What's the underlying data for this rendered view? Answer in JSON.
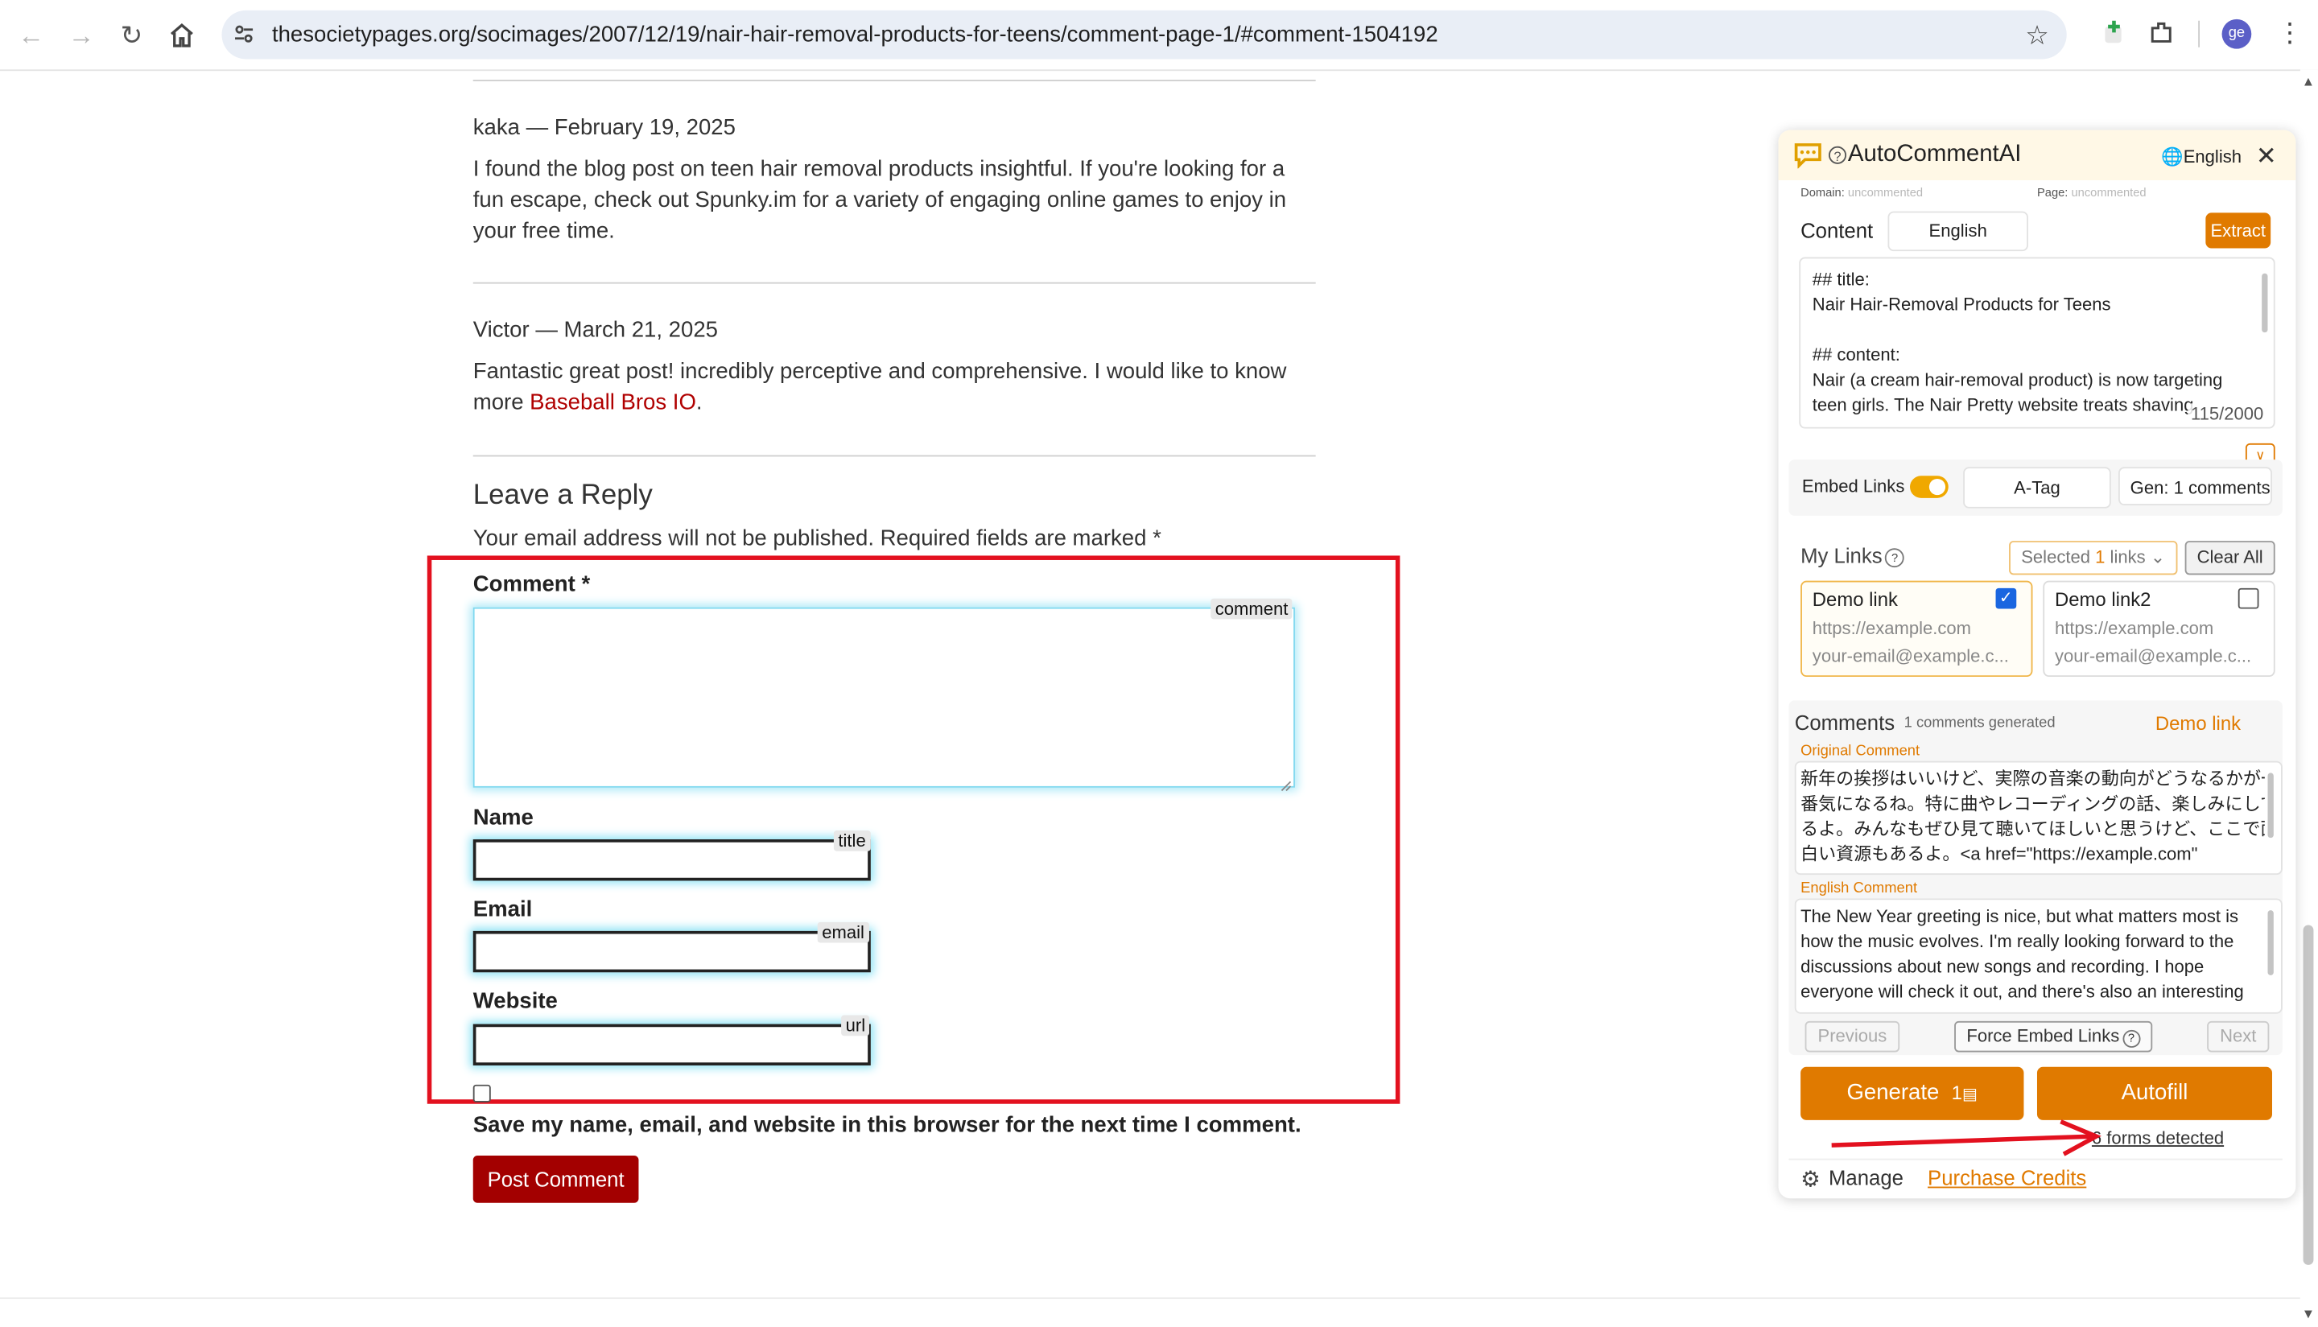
{
  "browser": {
    "url": "thesocietypages.org/socimages/2007/12/19/nair-hair-removal-products-for-teens/comment-page-1/#comment-1504192",
    "avatar_initials": "ge"
  },
  "comments": [
    {
      "author_date": "kaka — February 19, 2025",
      "lines": [
        "I found the blog post on teen hair removal products insightful. If you're looking for a",
        "fun escape, check out Spunky.im for a variety of engaging online games to enjoy in",
        "your free time."
      ]
    },
    {
      "author_date": "Victor — March 21, 2025",
      "line1": "Fantastic great post! incredibly perceptive and comprehensive. I would like to know",
      "line2_prefix": "more ",
      "link": "Baseball Bros IO",
      "line2_suffix": "."
    }
  ],
  "reply": {
    "heading": "Leave a Reply",
    "notice": "Your email address will not be published. Required fields are marked *",
    "comment_label": "Comment *",
    "comment_tag": "comment",
    "name_label": "Name",
    "name_tag": "title",
    "email_label": "Email",
    "email_tag": "email",
    "website_label": "Website",
    "website_tag": "url",
    "save_label": "Save my name, email, and website in this browser for the next time I comment.",
    "post_button": "Post Comment"
  },
  "ext": {
    "title": "AutoCommentAI",
    "language": "English",
    "domain_label": "Domain:",
    "domain_value": "uncommented",
    "page_label": "Page:",
    "page_value": "uncommented",
    "content_label": "Content",
    "content_lang": "English",
    "extract_button": "Extract",
    "content_lines": [
      "## title:",
      "Nair Hair-Removal Products for Teens",
      "",
      "## content:",
      "Nair (a cream hair-removal product) is now targeting",
      "teen girls. The Nair Pretty website treats shaving"
    ],
    "char_count": "115/2000",
    "embed_links_label": "Embed Links",
    "embed_links_on": true,
    "atag_label": "A-Tag",
    "gen_label": "Gen: 1 comments",
    "my_links_label": "My Links",
    "selected_prefix": "Selected ",
    "selected_count": "1",
    "selected_suffix": " links",
    "clear_all": "Clear All",
    "links": [
      {
        "name": "Demo link",
        "url": "https://example.com",
        "email": "your-email@example.c...",
        "checked": true
      },
      {
        "name": "Demo link2",
        "url": "https://example.com",
        "email": "your-email@example.c...",
        "checked": false
      }
    ],
    "comments_label": "Comments",
    "comments_generated": "1 comments generated",
    "active_link": "Demo link",
    "original_label": "Original Comment",
    "original_lines": [
      "新年の挨拶はいいけど、実際の音楽の動向がどうなるかが一",
      "番気になるね。特に曲やレコーディングの話、楽しみにして",
      "るよ。みんなもぜひ見て聴いてほしいと思うけど、ここで面",
      "白い資源もあるよ。<a href=\"https://example.com\""
    ],
    "english_label": "English Comment",
    "english_lines": [
      "The New Year greeting is nice, but what matters most is",
      "how the music evolves. I'm really looking forward to the",
      "discussions about new songs and recording. I hope",
      "everyone will check it out, and there's also an interesting"
    ],
    "previous_button": "Previous",
    "force_embed_button": "Force Embed Links",
    "next_button": "Next",
    "generate_button": "Generate",
    "generate_cost": "1",
    "autofill_button": "Autofill",
    "forms_detected": "6 forms detected",
    "manage_label": "Manage",
    "purchase_label": "Purchase Credits"
  },
  "colors": {
    "accent": "#e07a00",
    "link_red": "#b00000",
    "highlight_box": "#e3111f",
    "arrow": "#e3111f"
  }
}
